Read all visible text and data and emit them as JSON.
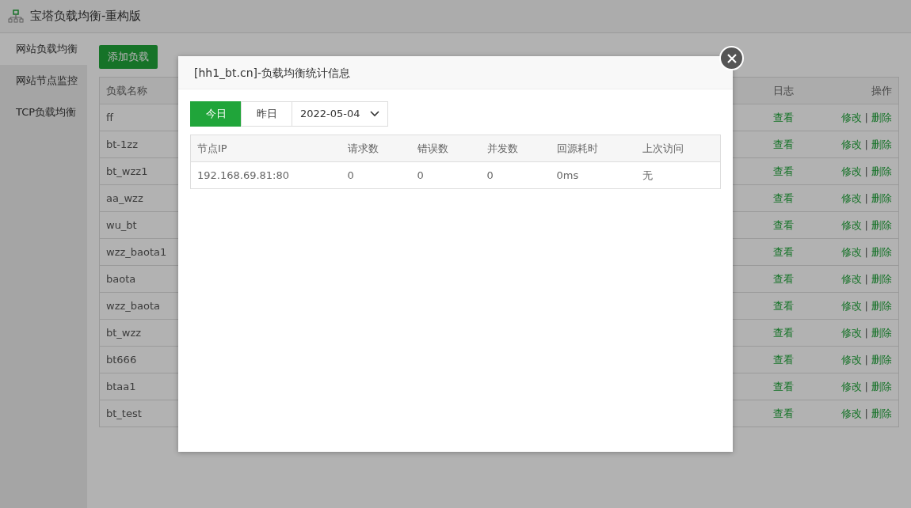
{
  "app": {
    "title": "宝塔负载均衡-重构版"
  },
  "sidebar": {
    "items": [
      {
        "label": "网站负载均衡",
        "selected": true
      },
      {
        "label": "网站节点监控",
        "selected": false
      },
      {
        "label": "TCP负载均衡",
        "selected": false
      }
    ]
  },
  "add_button": {
    "label": "添加负载"
  },
  "table": {
    "columns": [
      "负载名称",
      "日志",
      "操作"
    ],
    "rows": [
      {
        "name": "ff",
        "log": "查看",
        "edit": "修改",
        "separator": "|",
        "delete": "删除"
      },
      {
        "name": "bt-1zz",
        "log": "查看",
        "edit": "修改",
        "separator": "|",
        "delete": "删除"
      },
      {
        "name": "bt_wzz1",
        "log": "查看",
        "edit": "修改",
        "separator": "|",
        "delete": "删除"
      },
      {
        "name": "aa_wzz",
        "log": "查看",
        "edit": "修改",
        "separator": "|",
        "delete": "删除"
      },
      {
        "name": "wu_bt",
        "log": "查看",
        "edit": "修改",
        "separator": "|",
        "delete": "删除"
      },
      {
        "name": "wzz_baota1",
        "log": "查看",
        "edit": "修改",
        "separator": "|",
        "delete": "删除"
      },
      {
        "name": "baota",
        "log": "查看",
        "edit": "修改",
        "separator": "|",
        "delete": "删除"
      },
      {
        "name": "wzz_baota",
        "log": "查看",
        "edit": "修改",
        "separator": "|",
        "delete": "删除"
      },
      {
        "name": "bt_wzz",
        "log": "查看",
        "edit": "修改",
        "separator": "|",
        "delete": "删除"
      },
      {
        "name": "bt666",
        "log": "查看",
        "edit": "修改",
        "separator": "|",
        "delete": "删除"
      },
      {
        "name": "btaa1",
        "log": "查看",
        "edit": "修改",
        "separator": "|",
        "delete": "删除"
      },
      {
        "name": "bt_test",
        "log": "查看",
        "edit": "修改",
        "separator": "|",
        "delete": "删除"
      }
    ]
  },
  "modal": {
    "title": "[hh1_bt.cn]-负载均衡统计信息",
    "tabs": [
      {
        "label": "今日",
        "selected": true
      },
      {
        "label": "昨日",
        "selected": false
      }
    ],
    "date_select": {
      "value": "2022-05-04"
    },
    "table": {
      "columns": [
        "节点IP",
        "请求数",
        "错误数",
        "并发数",
        "回源耗时",
        "上次访问"
      ],
      "rows": [
        [
          "192.168.69.81:80",
          "0",
          "0",
          "0",
          "0ms",
          "无"
        ]
      ]
    }
  }
}
